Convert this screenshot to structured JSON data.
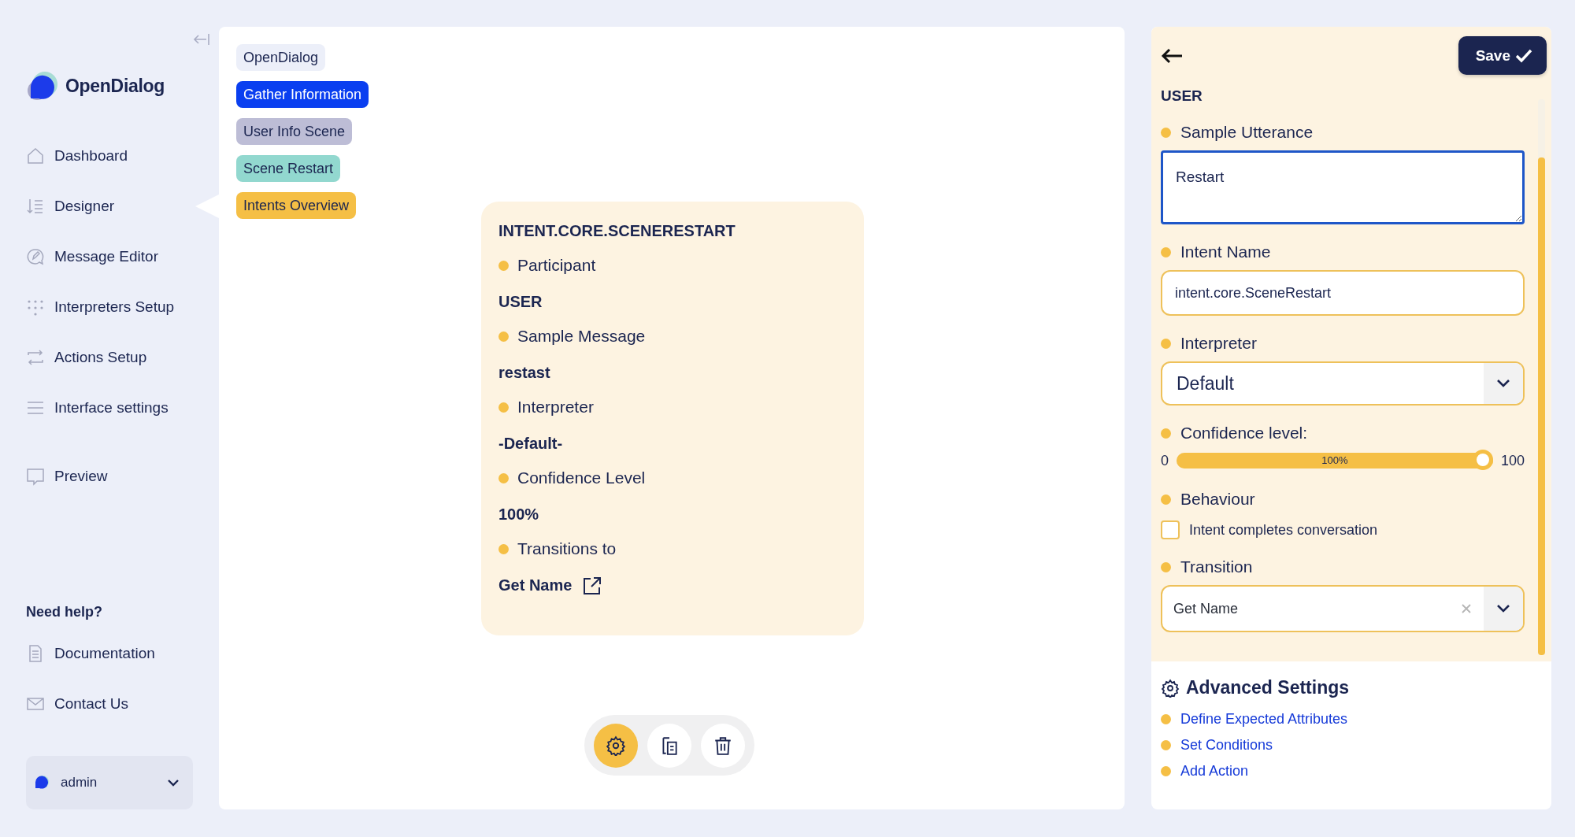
{
  "sidebar": {
    "logo": "OpenDialog",
    "nav": [
      {
        "label": "Dashboard",
        "kind": "home",
        "selected": false
      },
      {
        "label": "Designer",
        "kind": "designer",
        "selected": true
      },
      {
        "label": "Message Editor",
        "kind": "message",
        "selected": false
      },
      {
        "label": "Interpreters Setup",
        "kind": "dots",
        "selected": false
      },
      {
        "label": "Actions Setup",
        "kind": "swap",
        "selected": false
      },
      {
        "label": "Interface settings",
        "kind": "sliders",
        "selected": false
      }
    ],
    "nav_bottom": [
      {
        "label": "Preview",
        "kind": "preview",
        "selected": false
      }
    ],
    "help_title": "Need help?",
    "help_links": [
      {
        "label": "Documentation",
        "kind": "document"
      },
      {
        "label": "Contact Us",
        "kind": "mail"
      }
    ],
    "user": {
      "name": "admin"
    }
  },
  "breadcrumbs": [
    {
      "label": "OpenDialog",
      "color": "#eceff9"
    },
    {
      "label": "Gather Information",
      "color": "#0a3ff0"
    },
    {
      "label": "User Info Scene",
      "color": "#bdbdd6"
    },
    {
      "label": "Scene Restart",
      "color": "#92d8cf"
    },
    {
      "label": "Intents Overview",
      "color": "#f5bf45"
    }
  ],
  "intent_card": {
    "title": "INTENT.CORE.SCENERESTART",
    "rows": [
      {
        "label": "Participant",
        "value": "USER",
        "kind": "text"
      },
      {
        "label": "Sample Message",
        "value": "restast",
        "kind": "text"
      },
      {
        "label": "Interpreter",
        "value": "-Default-",
        "kind": "text"
      },
      {
        "label": "Confidence Level",
        "value": "100%",
        "kind": "text"
      },
      {
        "label": "Transitions to",
        "value": "Get Name",
        "kind": "link"
      }
    ]
  },
  "toolbar": [
    {
      "kind": "settings",
      "selected": true
    },
    {
      "kind": "duplicate",
      "selected": false
    },
    {
      "kind": "delete",
      "selected": false
    }
  ],
  "editor": {
    "save": "Save",
    "participant": "USER",
    "utterance": {
      "label": "Sample Utterance",
      "value": "Restart",
      "focused": true
    },
    "intent_name": {
      "label": "Intent Name",
      "value": "intent.core.SceneRestart"
    },
    "interpreter": {
      "label": "Interpreter",
      "value": "Default"
    },
    "confidence": {
      "label": "Confidence level:",
      "min": "0",
      "max": "100",
      "reading": "100%",
      "level": 1
    },
    "behaviour": {
      "label": "Behaviour",
      "option": "Intent completes conversation",
      "checked": false
    },
    "transition": {
      "label": "Transition",
      "value": "Get Name"
    },
    "advanced": {
      "title": "Advanced Settings",
      "links": [
        "Define Expected Attributes",
        "Set Conditions",
        "Add Action"
      ]
    }
  }
}
